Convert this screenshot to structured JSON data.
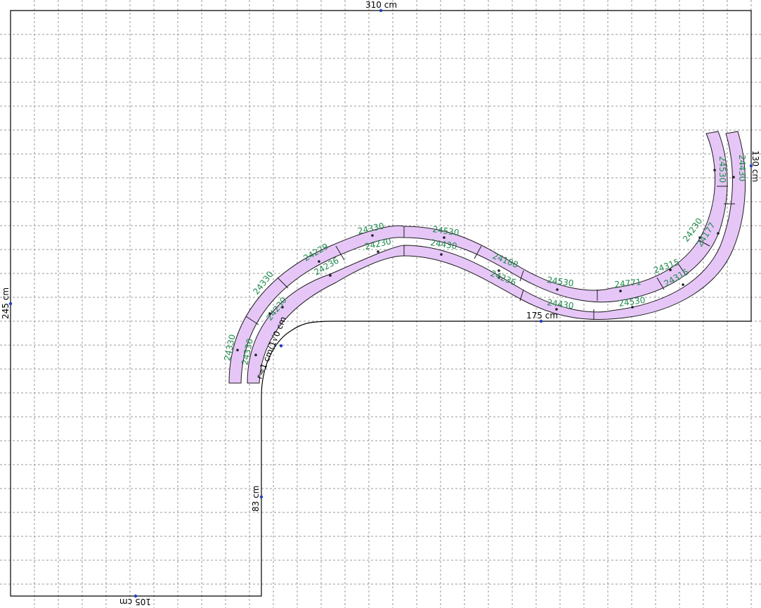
{
  "layout": {
    "dimensions": {
      "top_width": "310 cm",
      "left_height": "245 cm",
      "right_height": "130 cm",
      "inner_bottom": "175 cm",
      "stem_height": "83 cm",
      "bottom_width": "105 cm",
      "corner_radius": "r≈1 cm(1√0 cm"
    },
    "colors": {
      "track_fill": "#e6c6f7",
      "label_color": "#1e8a4c",
      "handle_color": "#1f3fbf",
      "grid_color": "#9a9a9a"
    },
    "track_labels": [
      "24330",
      "24330",
      "24230",
      "24330",
      "24229",
      "24236",
      "24330",
      "24230",
      "24530",
      "24430",
      "24188",
      "24236",
      "24530",
      "24430",
      "24771",
      "24530",
      "24315",
      "24315",
      "24230",
      "24177",
      "24530",
      "24430"
    ]
  }
}
